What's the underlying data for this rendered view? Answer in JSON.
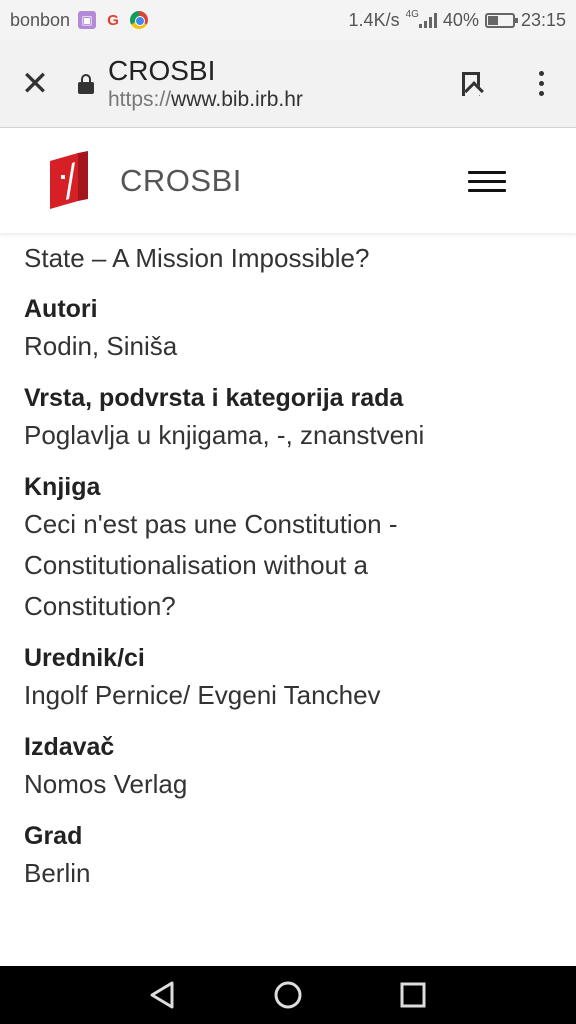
{
  "status_bar": {
    "carrier": "bonbon",
    "speed": "1.4K/s",
    "network": "4G",
    "battery": "40%",
    "time": "23:15",
    "icons": [
      "gallery-icon",
      "google-icon",
      "chrome-icon",
      "signal-icon",
      "battery-icon"
    ]
  },
  "browser": {
    "page_name": "CROSBI",
    "url_scheme": "https://",
    "url_host": "www.bib.irb.hr",
    "close_glyph": "✕"
  },
  "site": {
    "title": "CROSBI",
    "logo_color": "#d71f26"
  },
  "content": {
    "lead_line": "State – A Mission Impossible?",
    "fields": [
      {
        "label": "Autori",
        "lines": [
          "Rodin, Siniša"
        ]
      },
      {
        "label": "Vrsta, podvrsta i kategorija rada",
        "lines": [
          "Poglavlja u knjigama, -, znanstveni"
        ]
      },
      {
        "label": "Knjiga",
        "lines": [
          "Ceci n'est pas une Constitution -",
          "Constitutionalisation without a",
          "Constitution?"
        ]
      },
      {
        "label": "Urednik/ci",
        "lines": [
          "Ingolf Pernice/ Evgeni Tanchev"
        ]
      },
      {
        "label": "Izdavač",
        "lines": [
          "Nomos Verlag"
        ]
      },
      {
        "label": "Grad",
        "lines": [
          "Berlin"
        ]
      }
    ]
  },
  "nav": {
    "buttons": [
      "back-icon",
      "home-icon",
      "recents-icon"
    ]
  }
}
